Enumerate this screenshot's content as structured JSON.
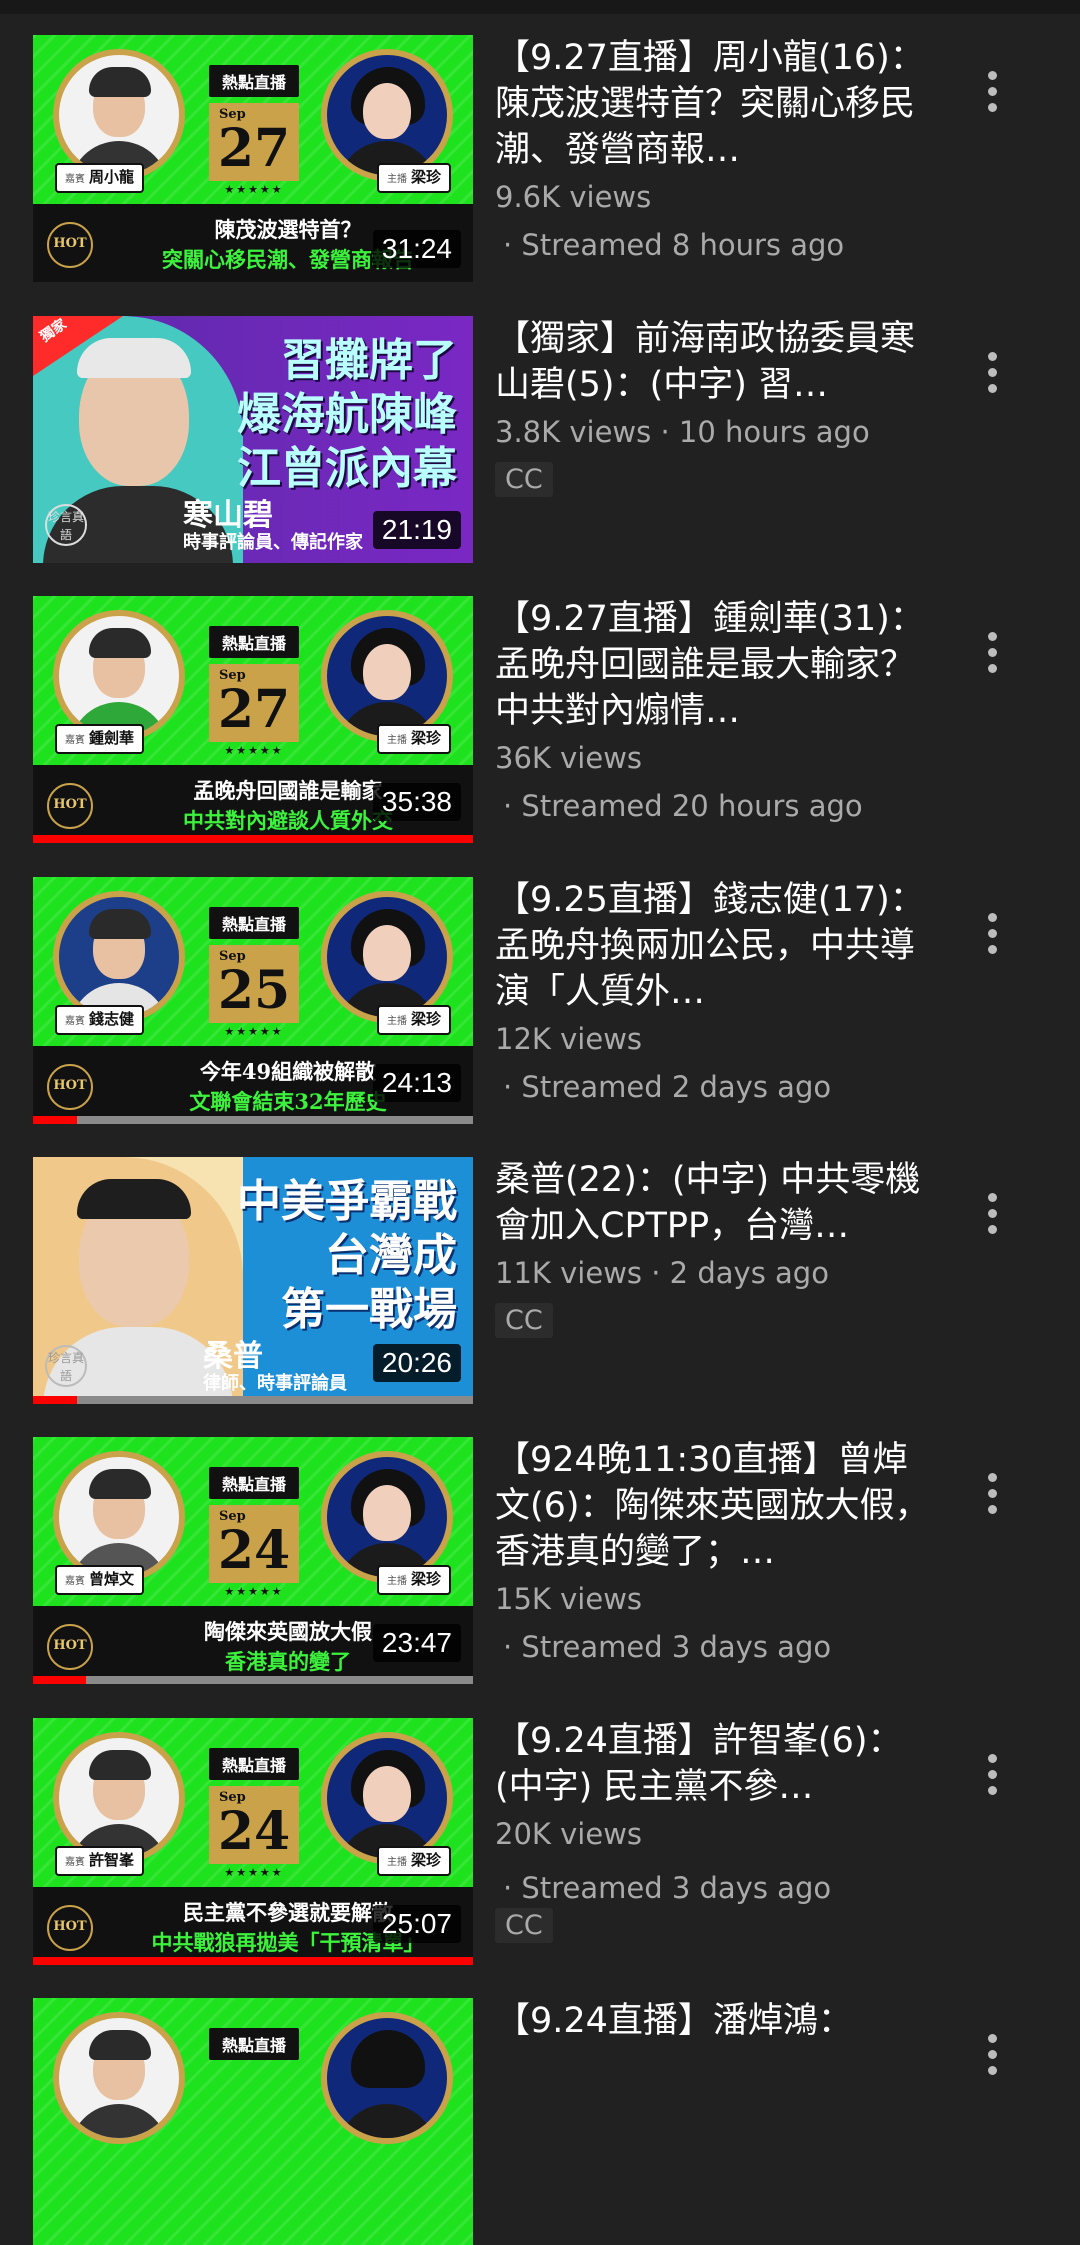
{
  "videos": [
    {
      "title": "【9.27直播】周小龍(16)：陳茂波選特首？突關心移民潮、發營商報…",
      "views": "9.6K views",
      "time": "· Streamed 8 hours ago",
      "duration": "31:24",
      "thumbnail": {
        "guest_role": "嘉賓",
        "guest": "周小龍",
        "host_role": "主播",
        "host": "梁珍",
        "badge": "熱點直播",
        "month": "Sep",
        "day": "27",
        "hot": "HOT",
        "line1": "陳茂波選特首？",
        "line2": "突關心移民潮、發營商報告"
      }
    },
    {
      "title": "【獨家】前海南政協委員寒山碧(5)：(中字) 習…",
      "views": "3.8K views · 10 hours ago",
      "cc": "CC",
      "duration": "21:19",
      "thumbnail": {
        "corner": "獨家",
        "headline": [
          "習攤牌了",
          "爆海航陳峰",
          "江曾派內幕"
        ],
        "name": "寒山碧",
        "sub": "時事評論員、傳記作家",
        "logo": "珍言真語"
      }
    },
    {
      "title": "【9.27直播】鍾劍華(31)：孟晚舟回國誰是最大輸家？中共對內煽情…",
      "views": "36K views",
      "time": "· Streamed 20 hours ago",
      "duration": "35:38",
      "progress": 1.0,
      "thumbnail": {
        "guest_role": "嘉賓",
        "guest": "鍾劍華",
        "host_role": "主播",
        "host": "梁珍",
        "badge": "熱點直播",
        "month": "Sep",
        "day": "27",
        "hot": "HOT",
        "line1": "孟晚舟回國誰是輸家",
        "line2": "中共對內避談人質外交"
      }
    },
    {
      "title": "【9.25直播】錢志健(17)：孟晚舟換兩加公民，中共導演「人質外…",
      "views": "12K views",
      "time": "· Streamed 2 days ago",
      "duration": "24:13",
      "progress": 0.1,
      "thumbnail": {
        "guest_role": "嘉賓",
        "guest": "錢志健",
        "host_role": "主播",
        "host": "梁珍",
        "badge": "熱點直播",
        "month": "Sep",
        "day": "25",
        "hot": "HOT",
        "line1": "今年49組織被解散",
        "line2": "文聯會結束32年歷史"
      }
    },
    {
      "title": "桑普(22)：(中字) 中共零機會加入CPTPP，台灣…",
      "views": "11K views · 2 days ago",
      "cc": "CC",
      "duration": "20:26",
      "progress": 0.1,
      "thumbnail": {
        "headline": [
          "中美爭霸戰",
          "台灣成",
          "第一戰場"
        ],
        "name": "桑普",
        "sub": "律師、時事評論員",
        "logo": "珍言真語"
      }
    },
    {
      "title": "【924晚11:30直播】曾焯文(6)：陶傑來英國放大假，香港真的變了；…",
      "views": "15K views",
      "time": "· Streamed 3 days ago",
      "duration": "23:47",
      "progress": 0.12,
      "thumbnail": {
        "guest_role": "嘉賓",
        "guest": "曾焯文",
        "host_role": "主播",
        "host": "梁珍",
        "badge": "熱點直播",
        "month": "Sep",
        "day": "24",
        "hot": "HOT",
        "line1": "陶傑來英國放大假",
        "line2": "香港真的變了"
      }
    },
    {
      "title": "【9.24直播】許智峯(6)：(中字) 民主黨不參…",
      "views": "20K views",
      "time": "· Streamed 3 days ago",
      "cc": "CC",
      "duration": "25:07",
      "progress": 1.0,
      "thumbnail": {
        "guest_role": "嘉賓",
        "guest": "許智峯",
        "host_role": "主播",
        "host": "梁珍",
        "badge": "熱點直播",
        "month": "Sep",
        "day": "24",
        "hot": "HOT",
        "line1": "民主黨不參選就要解散",
        "line2": "中共戰狼再拋美「干預清單」"
      }
    },
    {
      "title": "【9.24直播】潘焯鴻：",
      "thumbnail": {
        "badge": "熱點直播"
      }
    }
  ],
  "colors": {
    "background": "#212121",
    "secondary_text": "#aaaaaa",
    "progress": "#ff0000",
    "thumb_green": "#1fe21f"
  },
  "icons": {
    "more": "more-vert-icon"
  }
}
